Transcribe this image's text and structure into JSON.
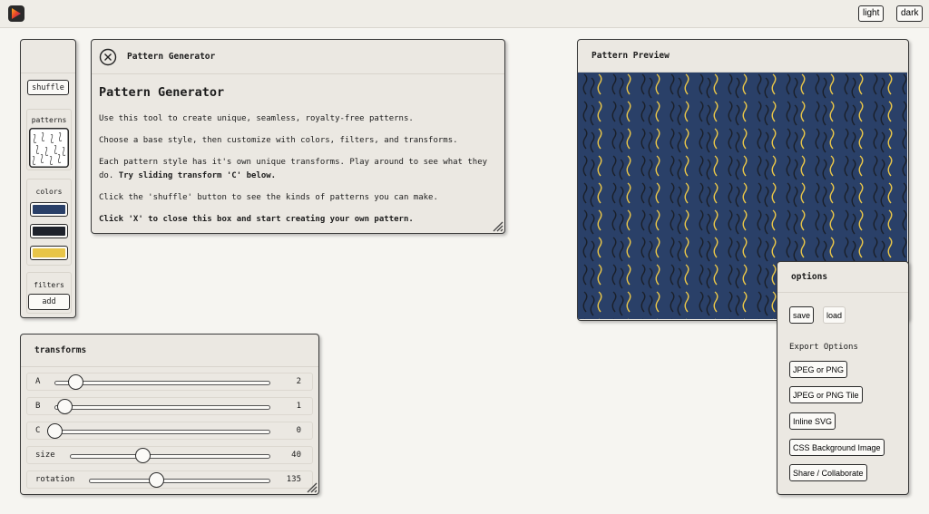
{
  "header": {
    "light_label": "light",
    "dark_label": "dark"
  },
  "sidebar": {
    "shuffle_label": "shuffle",
    "patterns_label": "patterns",
    "colors_label": "colors",
    "colors": [
      "#2a4068",
      "#1f232c",
      "#e8c548"
    ],
    "filters_label": "filters",
    "add_label": "add"
  },
  "intro": {
    "title": "Pattern Generator",
    "heading": "Pattern Generator",
    "p1": "Use this tool to create unique, seamless, royalty-free patterns.",
    "p2": "Choose a base style, then customize with colors, filters, and transforms.",
    "p3_text": "Each pattern style has it's own unique transforms. Play around to see what they do. ",
    "p3_bold": "Try sliding transform 'C' below.",
    "p4": "Click the 'shuffle' button to see the kinds of patterns you can make.",
    "p5": "Click 'X' to close this box and start creating your own pattern."
  },
  "transforms": {
    "title": "transforms",
    "rows": [
      {
        "name": "A",
        "value": "2"
      },
      {
        "name": "B",
        "value": "1"
      },
      {
        "name": "C",
        "value": "0"
      },
      {
        "name": "size",
        "value": "40"
      },
      {
        "name": "rotation",
        "value": "135"
      }
    ]
  },
  "preview": {
    "title": "Pattern Preview"
  },
  "options": {
    "title": "options",
    "save_label": "save",
    "load_label": "load",
    "export_heading": "Export Options",
    "exports": [
      "JPEG or PNG",
      "JPEG or PNG Tile",
      "Inline SVG",
      "CSS Background Image",
      "Share / Collaborate"
    ]
  }
}
